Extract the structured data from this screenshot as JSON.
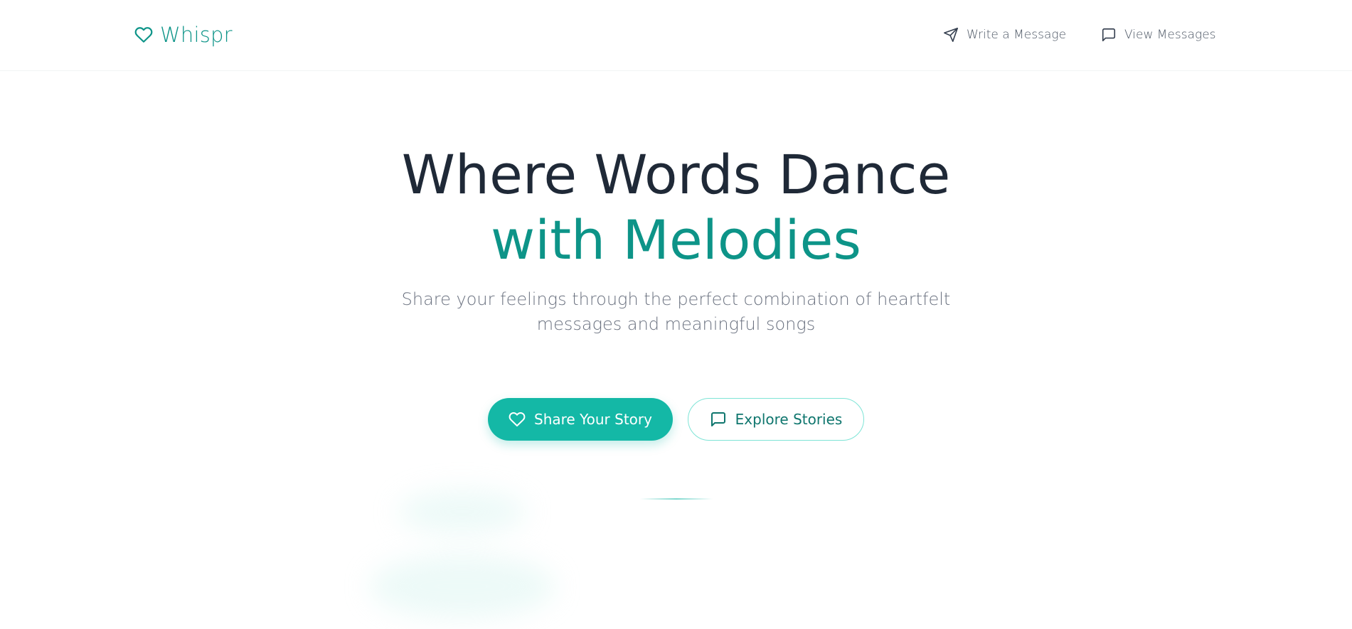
{
  "header": {
    "logo_text": "Whispr",
    "nav": [
      {
        "label": "Write a Message",
        "icon": "send-icon"
      },
      {
        "label": "View Messages",
        "icon": "message-square-icon"
      }
    ]
  },
  "hero": {
    "title_line1": "Where Words Dance",
    "title_line2": "with Melodies",
    "subtitle": "Share your feelings through the perfect combination of heartfelt messages and meaningful songs",
    "buttons": {
      "primary": {
        "label": "Share Your Story",
        "icon": "heart-icon"
      },
      "secondary": {
        "label": "Explore Stories",
        "icon": "message-square-icon"
      }
    }
  },
  "colors": {
    "accent": "#0d9488",
    "button_fill": "#14b8a6",
    "heading": "#1f2937",
    "muted_text": "#6b7280"
  }
}
